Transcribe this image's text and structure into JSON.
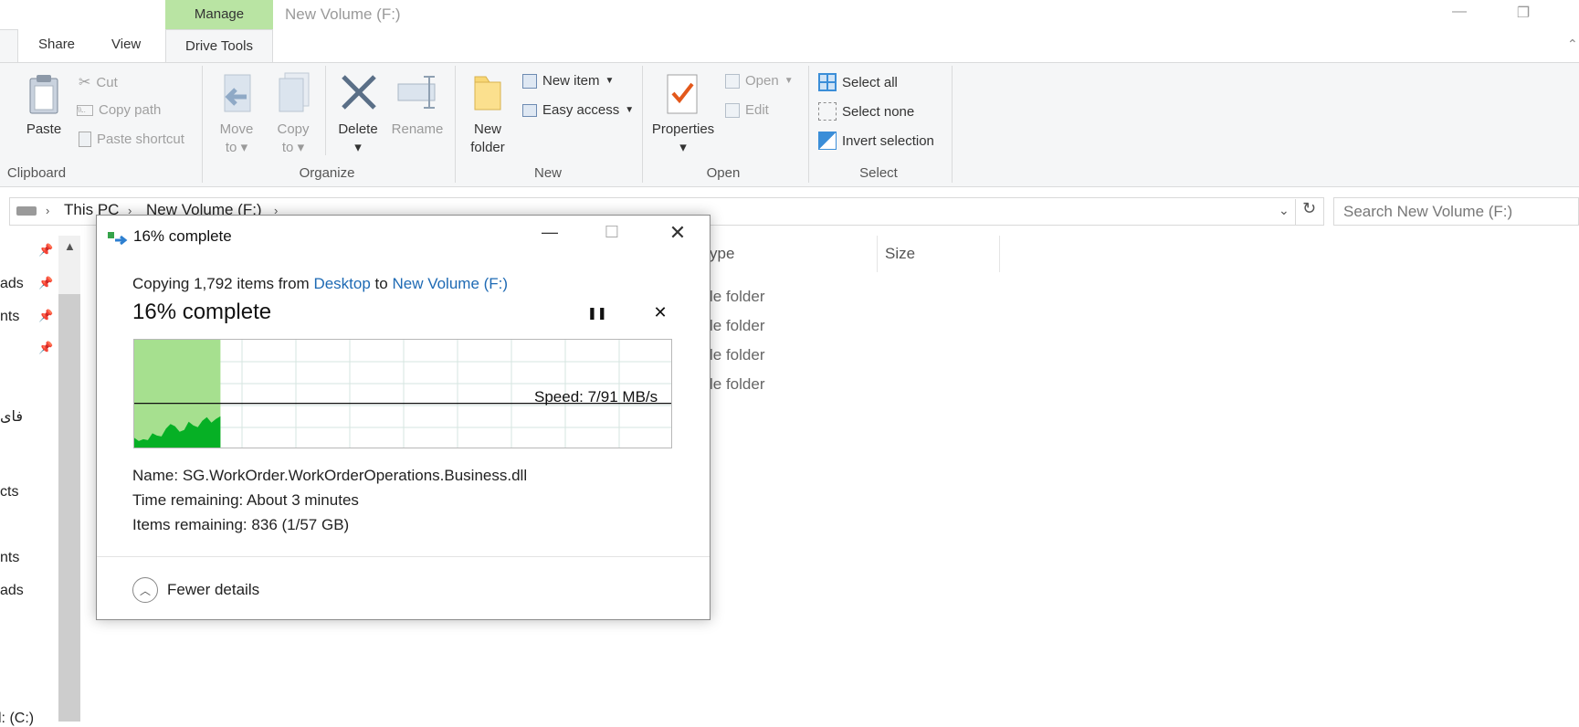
{
  "titlebar": {
    "manage_tab": "Manage",
    "window_title": "New Volume (F:)"
  },
  "tabs": {
    "share": "Share",
    "view": "View",
    "drive_tools": "Drive Tools"
  },
  "ribbon": {
    "clipboard": {
      "paste": "Paste",
      "cut": "Cut",
      "copy_path": "Copy path",
      "paste_shortcut": "Paste shortcut",
      "group": "Clipboard"
    },
    "organize": {
      "move_to_1": "Move",
      "move_to_2": "to",
      "copy_to_1": "Copy",
      "copy_to_2": "to",
      "delete": "Delete",
      "rename": "Rename",
      "group": "Organize"
    },
    "new": {
      "new_folder_1": "New",
      "new_folder_2": "folder",
      "new_item": "New item",
      "easy_access": "Easy access",
      "group": "New"
    },
    "open": {
      "properties": "Properties",
      "open": "Open",
      "edit": "Edit",
      "group": "Open"
    },
    "select": {
      "select_all": "Select all",
      "select_none": "Select none",
      "invert_selection": "Invert selection",
      "group": "Select"
    }
  },
  "address": {
    "crumb1": "This PC",
    "crumb2": "New Volume (F:)",
    "search_placeholder": "Search New Volume (F:)"
  },
  "nav_items": [
    "ads",
    "nts",
    "فای",
    "cts",
    "nts",
    "ads",
    "l: (C:)"
  ],
  "columns": {
    "type": "ype",
    "size": "Size"
  },
  "file_types": [
    "le folder",
    "le folder",
    "le folder",
    "le folder"
  ],
  "dialog": {
    "title": "16% complete",
    "copying_prefix": "Copying 1,792 items from",
    "source": "Desktop",
    "to": "to",
    "destination": "New Volume (F:)",
    "percent": "16% complete",
    "progress_fraction": 0.16,
    "speed_label": "Speed: 7/91 MB/s",
    "name_label": "Name:",
    "name_value": "SG.WorkOrder.WorkOrderOperations.Business.dll",
    "time_label": "Time remaining:",
    "time_value": "About 3 minutes",
    "items_label": "Items remaining:",
    "items_value": "836 (1/57 GB)",
    "fewer_details": "Fewer details",
    "pause_icon": "❚❚",
    "cancel_icon": "✕"
  },
  "colors": {
    "manage_tab": "#b9e4a3",
    "progress_fill": "#a6e08f",
    "speed_fill": "#06b025",
    "link": "#1e6ab4",
    "ribbon_bg": "#f5f6f7"
  }
}
